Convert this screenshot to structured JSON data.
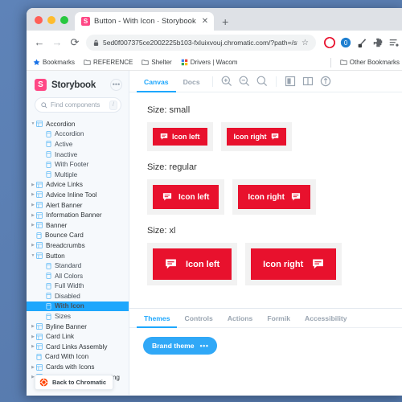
{
  "browser": {
    "tab": {
      "title": "Button - With Icon · Storybook",
      "favicon_letter": "S",
      "close_label": "✕"
    },
    "new_tab_label": "+",
    "nav": {
      "back": "←",
      "forward": "→",
      "reload": "⟳"
    },
    "omnibox": {
      "lock_icon": "🔒",
      "url": "5ed0f007375ce2002225b103-fxluixvouj.chromatic.com/?path=/stor…",
      "star": "☆"
    },
    "extensions": [
      "opera-icon",
      "adblock-icon",
      "colorpicker-icon",
      "puzzle-extension-icon",
      "menu-list-icon"
    ],
    "bookmarks": [
      {
        "label": "Bookmarks",
        "icon": "star-icon"
      },
      {
        "label": "REFERENCE",
        "icon": "folder-icon"
      },
      {
        "label": "Shelter",
        "icon": "folder-icon"
      },
      {
        "label": "Drivers | Wacom",
        "icon": "colorful-icon"
      }
    ],
    "other_bookmarks": {
      "label": "Other Bookmarks",
      "icon": "folder-icon"
    }
  },
  "sidebar": {
    "brand": {
      "logo_letter": "S",
      "name": "Storybook",
      "menu_label": "•••"
    },
    "search": {
      "placeholder": "Find components",
      "shortcut": "/",
      "icon": "search-icon"
    },
    "tree": [
      {
        "label": "Accordion",
        "level": 1,
        "type": "group",
        "expanded": true,
        "selected": false
      },
      {
        "label": "Accordion",
        "level": 2,
        "type": "story",
        "expanded": false,
        "selected": false
      },
      {
        "label": "Active",
        "level": 2,
        "type": "story",
        "expanded": false,
        "selected": false
      },
      {
        "label": "Inactive",
        "level": 2,
        "type": "story",
        "expanded": false,
        "selected": false
      },
      {
        "label": "With Footer",
        "level": 2,
        "type": "story",
        "expanded": false,
        "selected": false
      },
      {
        "label": "Multiple",
        "level": 2,
        "type": "story",
        "expanded": false,
        "selected": false
      },
      {
        "label": "Advice Links",
        "level": 1,
        "type": "group",
        "expanded": false,
        "selected": false
      },
      {
        "label": "Advice Inline Tool",
        "level": 1,
        "type": "group",
        "expanded": false,
        "selected": false
      },
      {
        "label": "Alert Banner",
        "level": 1,
        "type": "group",
        "expanded": false,
        "selected": false
      },
      {
        "label": "Information Banner",
        "level": 1,
        "type": "group",
        "expanded": false,
        "selected": false
      },
      {
        "label": "Banner",
        "level": 1,
        "type": "group",
        "expanded": false,
        "selected": false
      },
      {
        "label": "Bounce Card",
        "level": 1,
        "type": "story",
        "expanded": false,
        "selected": false
      },
      {
        "label": "Breadcrumbs",
        "level": 1,
        "type": "group",
        "expanded": false,
        "selected": false
      },
      {
        "label": "Button",
        "level": 1,
        "type": "group",
        "expanded": true,
        "selected": false
      },
      {
        "label": "Standard",
        "level": 2,
        "type": "story",
        "expanded": false,
        "selected": false
      },
      {
        "label": "All Colors",
        "level": 2,
        "type": "story",
        "expanded": false,
        "selected": false
      },
      {
        "label": "Full Width",
        "level": 2,
        "type": "story",
        "expanded": false,
        "selected": false
      },
      {
        "label": "Disabled",
        "level": 2,
        "type": "story",
        "expanded": false,
        "selected": false
      },
      {
        "label": "With Icon",
        "level": 2,
        "type": "story",
        "expanded": false,
        "selected": true
      },
      {
        "label": "Sizes",
        "level": 2,
        "type": "story",
        "expanded": false,
        "selected": false
      },
      {
        "label": "Byline Banner",
        "level": 1,
        "type": "group",
        "expanded": false,
        "selected": false
      },
      {
        "label": "Card Link",
        "level": 1,
        "type": "group",
        "expanded": false,
        "selected": false
      },
      {
        "label": "Card Links Assembly",
        "level": 1,
        "type": "group",
        "expanded": false,
        "selected": false
      },
      {
        "label": "Card With Icon",
        "level": 1,
        "type": "story",
        "expanded": false,
        "selected": false
      },
      {
        "label": "Cards with Icons",
        "level": 1,
        "type": "group",
        "expanded": false,
        "selected": false
      },
      {
        "label": "Content Block Alternating",
        "level": 1,
        "type": "group",
        "expanded": false,
        "selected": false
      }
    ],
    "footer_button": {
      "label": "Back to Chromatic",
      "icon": "chromatic-icon"
    }
  },
  "toolbar": {
    "tabs": [
      {
        "label": "Canvas",
        "active": true
      },
      {
        "label": "Docs",
        "active": false
      }
    ],
    "icons": [
      {
        "name": "zoom-in-icon"
      },
      {
        "name": "zoom-out-icon"
      },
      {
        "name": "zoom-reset-icon"
      }
    ],
    "icons2": [
      {
        "name": "background-icon"
      },
      {
        "name": "grid-icon"
      },
      {
        "name": "measure-icon"
      }
    ]
  },
  "preview": {
    "accent_red": "#e8112d",
    "sections": [
      {
        "label": "Size: small",
        "size": "small",
        "buttons": [
          {
            "label": "Icon left",
            "icon": "comment-icon",
            "icon_side": "left"
          },
          {
            "label": "Icon right",
            "icon": "comment-icon",
            "icon_side": "right"
          }
        ]
      },
      {
        "label": "Size: regular",
        "size": "regular",
        "buttons": [
          {
            "label": "Icon left",
            "icon": "comment-icon",
            "icon_side": "left"
          },
          {
            "label": "Icon right",
            "icon": "comment-icon",
            "icon_side": "right"
          }
        ]
      },
      {
        "label": "Size: xl",
        "size": "xl",
        "buttons": [
          {
            "label": "Icon left",
            "icon": "comment-icon",
            "icon_side": "left"
          },
          {
            "label": "Icon right",
            "icon": "comment-icon",
            "icon_side": "right"
          }
        ]
      }
    ]
  },
  "addons": {
    "tabs": [
      {
        "label": "Themes",
        "active": true
      },
      {
        "label": "Controls",
        "active": false
      },
      {
        "label": "Actions",
        "active": false
      },
      {
        "label": "Formik",
        "active": false
      },
      {
        "label": "Accessibility",
        "active": false
      }
    ],
    "theme_pill": {
      "label": "Brand theme",
      "menu": "•••",
      "color": "#30a8f7"
    }
  }
}
